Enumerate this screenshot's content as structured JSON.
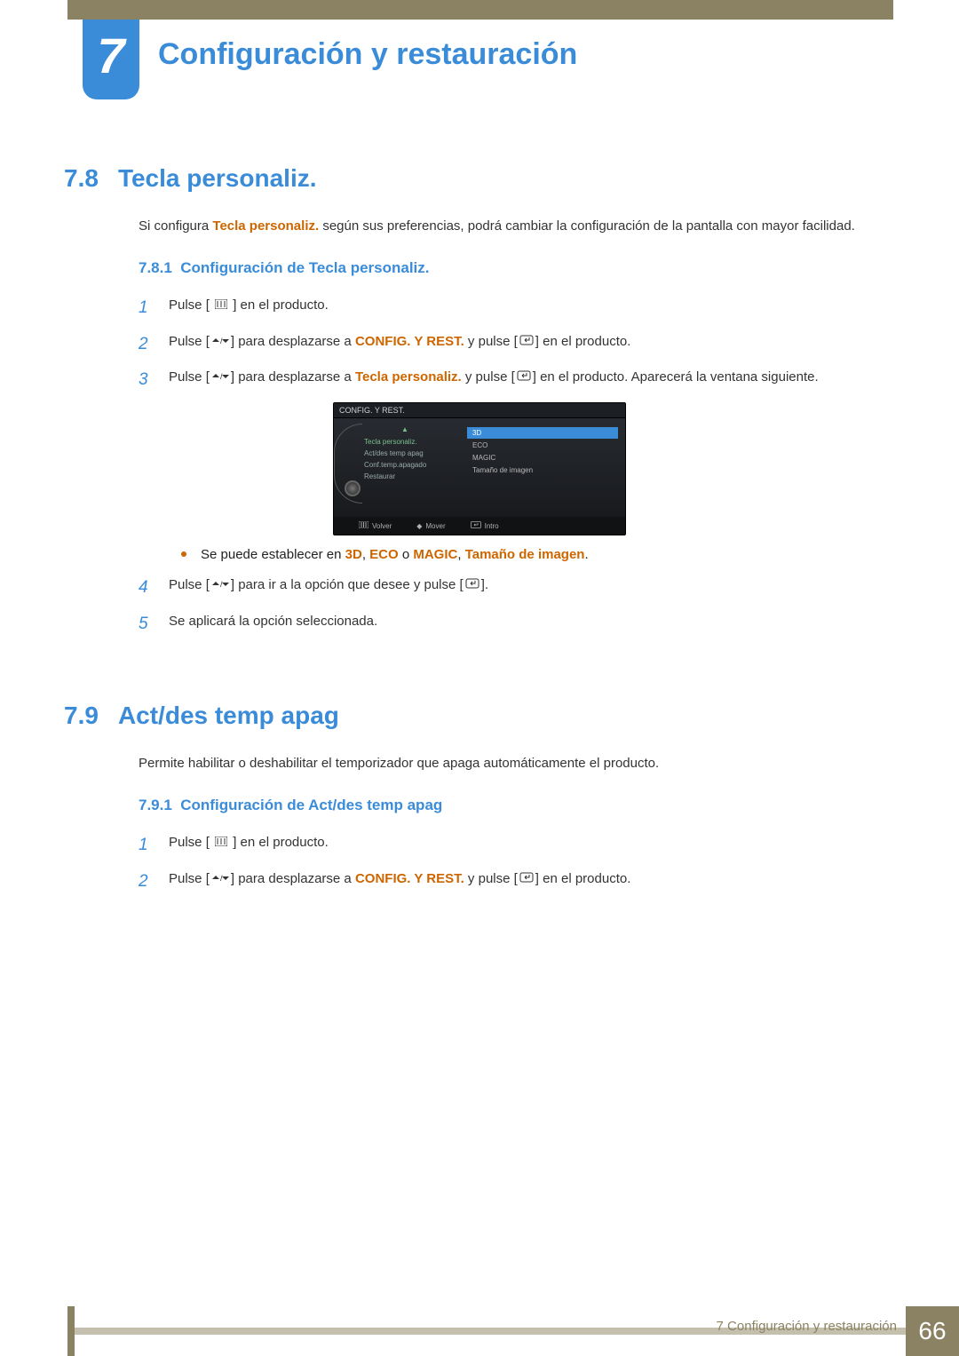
{
  "chapter": {
    "number": "7",
    "title": "Configuración y restauración"
  },
  "section_78": {
    "number": "7.8",
    "title": "Tecla personaliz.",
    "intro_pre": "Si configura ",
    "intro_bold": "Tecla personaliz.",
    "intro_post": " según sus preferencias, podrá cambiar la configuración de la pantalla con mayor facilidad.",
    "sub1": {
      "number": "7.8.1",
      "title": "Configuración de Tecla personaliz."
    },
    "steps": {
      "s1": {
        "n": "1",
        "pre": "Pulse [ ",
        "post": " ] en el producto."
      },
      "s2": {
        "n": "2",
        "pre": "Pulse [",
        "mid1": "] para desplazarse a ",
        "bold": "CONFIG. Y REST.",
        "mid2": " y pulse [",
        "post": "] en el producto."
      },
      "s3": {
        "n": "3",
        "pre": "Pulse [",
        "mid1": "] para desplazarse a ",
        "bold": "Tecla personaliz.",
        "mid2": " y pulse [",
        "post": "] en el producto. Aparecerá la ventana siguiente."
      },
      "bullet": {
        "pre": "Se puede establecer en ",
        "o1": "3D",
        "sep1": ", ",
        "o2": "ECO",
        "sep2": " o ",
        "o3": "MAGIC",
        "sep3": ", ",
        "o4": "Tamaño de imagen",
        "post": "."
      },
      "s4": {
        "n": "4",
        "pre": "Pulse [",
        "mid": "] para ir a la opción que desee y pulse [",
        "post": "]."
      },
      "s5": {
        "n": "5",
        "text": "Se aplicará la opción seleccionada."
      }
    }
  },
  "osd": {
    "title": "CONFIG. Y REST.",
    "left": {
      "i1": "Tecla personaliz.",
      "i2": "Act/des temp apag",
      "i3": "Conf.temp.apagado",
      "i4": "Restaurar"
    },
    "right": {
      "i1": "3D",
      "i2": "ECO",
      "i3": "MAGIC",
      "i4": "Tamaño de imagen"
    },
    "footer": {
      "back": "Volver",
      "move": "Mover",
      "enter": "Intro"
    }
  },
  "section_79": {
    "number": "7.9",
    "title": "Act/des temp apag",
    "intro": "Permite habilitar o deshabilitar el temporizador que apaga automáticamente el producto.",
    "sub1": {
      "number": "7.9.1",
      "title": "Configuración de Act/des temp apag"
    },
    "steps": {
      "s1": {
        "n": "1",
        "pre": "Pulse [ ",
        "post": " ] en el producto."
      },
      "s2": {
        "n": "2",
        "pre": "Pulse [",
        "mid1": "] para desplazarse a ",
        "bold": "CONFIG. Y REST.",
        "mid2": " y pulse [",
        "post": "] en el producto."
      }
    }
  },
  "footer": {
    "text": "7 Configuración y restauración",
    "page": "66"
  }
}
